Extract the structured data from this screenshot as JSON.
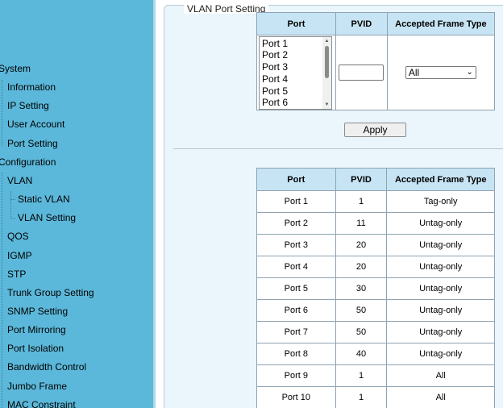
{
  "sidebar": {
    "items": [
      {
        "label": "System",
        "level": 0
      },
      {
        "label": "Information",
        "level": 1
      },
      {
        "label": "IP Setting",
        "level": 1
      },
      {
        "label": "User Account",
        "level": 1
      },
      {
        "label": "Port Setting",
        "level": 1
      },
      {
        "label": "Configuration",
        "level": 0
      },
      {
        "label": "VLAN",
        "level": 1
      },
      {
        "label": "Static VLAN",
        "level": 2
      },
      {
        "label": "VLAN Setting",
        "level": 2
      },
      {
        "label": "QOS",
        "level": 1
      },
      {
        "label": "IGMP",
        "level": 1
      },
      {
        "label": "STP",
        "level": 1
      },
      {
        "label": "Trunk Group Setting",
        "level": 1
      },
      {
        "label": "SNMP Setting",
        "level": 1
      },
      {
        "label": "Port Mirroring",
        "level": 1
      },
      {
        "label": "Port Isolation",
        "level": 1
      },
      {
        "label": "Bandwidth Control",
        "level": 1
      },
      {
        "label": "Jumbo Frame",
        "level": 1
      },
      {
        "label": "MAC Constraint",
        "level": 1
      }
    ]
  },
  "panel": {
    "legend": "VLAN Port Setting",
    "edit_table": {
      "headers": [
        "Port",
        "PVID",
        "Accepted Frame Type"
      ],
      "port_options": [
        "Port 1",
        "Port 2",
        "Port 3",
        "Port 4",
        "Port 5",
        "Port 6"
      ],
      "pvid_value": "",
      "frame_type_selected": "All"
    },
    "apply_label": "Apply",
    "status_table": {
      "headers": [
        "Port",
        "PVID",
        "Accepted Frame Type"
      ],
      "rows": [
        [
          "Port 1",
          "1",
          "Tag-only"
        ],
        [
          "Port 2",
          "11",
          "Untag-only"
        ],
        [
          "Port 3",
          "20",
          "Untag-only"
        ],
        [
          "Port 4",
          "20",
          "Untag-only"
        ],
        [
          "Port 5",
          "30",
          "Untag-only"
        ],
        [
          "Port 6",
          "50",
          "Untag-only"
        ],
        [
          "Port 7",
          "50",
          "Untag-only"
        ],
        [
          "Port 8",
          "40",
          "Untag-only"
        ],
        [
          "Port 9",
          "1",
          "All"
        ],
        [
          "Port 10",
          "1",
          "All"
        ]
      ]
    }
  },
  "colors": {
    "sidebar_bg": "#5bb8da",
    "panel_bg": "#eaf6fb",
    "header_bg": "#c6e4f4"
  }
}
